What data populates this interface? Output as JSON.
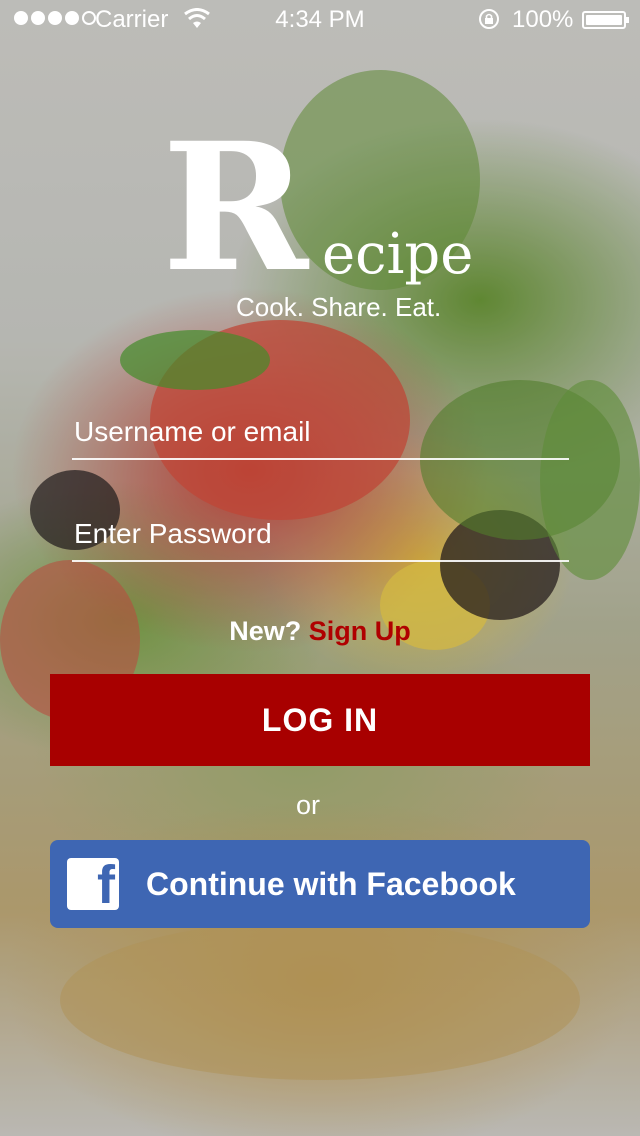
{
  "status_bar": {
    "carrier": "Carrier",
    "time": "4:34 PM",
    "battery": "100%",
    "signal_icon": "signal-dots-icon",
    "wifi_icon": "wifi-icon",
    "rotation_lock_icon": "rotation-lock-icon",
    "battery_icon": "battery-icon"
  },
  "logo": {
    "initial": "R",
    "rest": "ecipe",
    "tagline": "Cook. Share. Eat."
  },
  "login_form": {
    "username_placeholder": "Username or email",
    "password_placeholder": "Enter Password",
    "new_prompt": "New?",
    "signup_label": "Sign Up",
    "login_button": "LOG IN",
    "or_text": "or",
    "facebook_button": "Continue with Facebook",
    "facebook_icon": "facebook-icon"
  },
  "colors": {
    "login_button": "#a80000",
    "signup_link": "#b00000",
    "facebook_button": "#3e66b3"
  }
}
